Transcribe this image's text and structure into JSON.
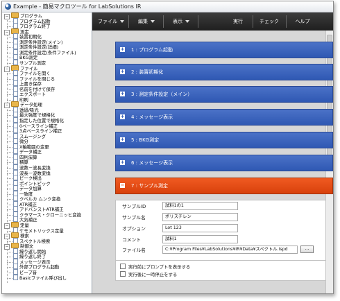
{
  "window": {
    "title": "Example - 簡易マクロツール for LabSolutions IR"
  },
  "toolbar": {
    "file": "ファイル",
    "edit": "編集",
    "view": "表示",
    "run": "実行",
    "check": "チェック",
    "help": "ヘルプ"
  },
  "tree": [
    {
      "label": "プログラム",
      "type": "folder",
      "level": 1,
      "exp": "−"
    },
    {
      "label": "プログラム起動",
      "type": "leaf",
      "level": 2
    },
    {
      "label": "プログラム終了",
      "type": "leaf",
      "level": 2
    },
    {
      "label": "測定",
      "type": "folder",
      "level": 1,
      "exp": "−"
    },
    {
      "label": "装置初期化",
      "type": "leaf",
      "level": 2
    },
    {
      "label": "測定条件設定(メイン)",
      "type": "leaf",
      "level": 2
    },
    {
      "label": "測定条件設定(詳細)",
      "type": "leaf",
      "level": 2
    },
    {
      "label": "測定条件設定(条件ファイル)",
      "type": "leaf",
      "level": 2
    },
    {
      "label": "BKG測定",
      "type": "leaf",
      "level": 2
    },
    {
      "label": "サンプル測定",
      "type": "leaf",
      "level": 2
    },
    {
      "label": "ファイル",
      "type": "folder",
      "level": 1,
      "exp": "−"
    },
    {
      "label": "ファイルを開く",
      "type": "leaf",
      "level": 2
    },
    {
      "label": "ファイルを閉じる",
      "type": "leaf",
      "level": 2
    },
    {
      "label": "上書き保存",
      "type": "leaf",
      "level": 2
    },
    {
      "label": "名前を付けて保存",
      "type": "leaf",
      "level": 2
    },
    {
      "label": "エクスポート",
      "type": "leaf",
      "level": 2
    },
    {
      "label": "印刷",
      "type": "leaf",
      "level": 2
    },
    {
      "label": "データ処理",
      "type": "folder",
      "level": 1,
      "exp": "−"
    },
    {
      "label": "透過/吸光",
      "type": "leaf",
      "level": 2
    },
    {
      "label": "最大強度で規格化",
      "type": "leaf",
      "level": 2
    },
    {
      "label": "指定した位置で規格化",
      "type": "leaf",
      "level": 2
    },
    {
      "label": "0ベースライン補正",
      "type": "leaf",
      "level": 2
    },
    {
      "label": "3点ベースライン補正",
      "type": "leaf",
      "level": 2
    },
    {
      "label": "スムージング",
      "type": "leaf",
      "level": 2
    },
    {
      "label": "微分",
      "type": "leaf",
      "level": 2
    },
    {
      "label": "X軸範囲の変更",
      "type": "leaf",
      "level": 2
    },
    {
      "label": "データ補正",
      "type": "leaf",
      "level": 2
    },
    {
      "label": "四則演算",
      "type": "leaf",
      "level": 2
    },
    {
      "label": "積算",
      "type": "leaf",
      "level": 2
    },
    {
      "label": "波数－波長変換",
      "type": "leaf",
      "level": 2
    },
    {
      "label": "波長－波数変換",
      "type": "leaf",
      "level": 2
    },
    {
      "label": "ピーク検出",
      "type": "leaf",
      "level": 2
    },
    {
      "label": "ポイントピック",
      "type": "leaf",
      "level": 2
    },
    {
      "label": "データ加算",
      "type": "leaf",
      "level": 2
    },
    {
      "label": "一致度",
      "type": "leaf",
      "level": 2
    },
    {
      "label": "クベルカ ムンク変換",
      "type": "leaf",
      "level": 2
    },
    {
      "label": "ATR補正",
      "type": "leaf",
      "level": 2
    },
    {
      "label": "アドバンストATR補正",
      "type": "leaf",
      "level": 2
    },
    {
      "label": "クラマース・クローニッヒ変換",
      "type": "leaf",
      "level": 2
    },
    {
      "label": "大気補正",
      "type": "leaf",
      "level": 2
    },
    {
      "label": "定量",
      "type": "folder",
      "level": 1,
      "exp": "−"
    },
    {
      "label": "ケモメトリックス定量",
      "type": "leaf",
      "level": 2
    },
    {
      "label": "検索",
      "type": "folder",
      "level": 1,
      "exp": "−"
    },
    {
      "label": "スペクトル検索",
      "type": "leaf",
      "level": 2
    },
    {
      "label": "制御文",
      "type": "folder",
      "level": 1,
      "exp": "−"
    },
    {
      "label": "繰り返し開始",
      "type": "leaf",
      "level": 2
    },
    {
      "label": "繰り返し終了",
      "type": "leaf",
      "level": 2
    },
    {
      "label": "メッセージ表示",
      "type": "leaf",
      "level": 2
    },
    {
      "label": "外部プログラム起動",
      "type": "leaf",
      "level": 2
    },
    {
      "label": "ビープ音",
      "type": "leaf",
      "level": 2
    },
    {
      "label": "Basicファイル呼び出し",
      "type": "leaf",
      "level": 2
    }
  ],
  "sections": [
    {
      "label": "1 : プログラム起動",
      "active": false,
      "icon": "+"
    },
    {
      "label": "2 : 装置初期化",
      "active": false,
      "icon": "+"
    },
    {
      "label": "3 : 測定条件設定（メイン）",
      "active": false,
      "icon": "+"
    },
    {
      "label": "4 : メッセージ表示",
      "active": false,
      "icon": "+"
    },
    {
      "label": "5 : BKG測定",
      "active": false,
      "icon": "+"
    },
    {
      "label": "6 : メッセージ表示",
      "active": false,
      "icon": "+"
    },
    {
      "label": "7 : サンプル測定",
      "active": true,
      "icon": "−"
    }
  ],
  "sample": {
    "id_label": "サンプルID",
    "id_value": "試料1の1",
    "name_label": "サンプル名",
    "name_value": "ポリスチレン",
    "option_label": "オプション",
    "option_value": "Lot 123",
    "comment_label": "コメント",
    "comment_value": "試料1",
    "file_label": "ファイル名",
    "file_value": "C:¥Program Files¥LabSolutions¥IR¥Data¥スペクトル.ispd",
    "browse_label": "..."
  },
  "checks": {
    "prompt_label": "実行前にプロンプトを表示する",
    "pause_label": "実行後に一時停止をする"
  },
  "colors": {
    "section_blue": "#2f58b3",
    "section_active": "#d8410c",
    "toolbar": "#2a2a2a"
  }
}
